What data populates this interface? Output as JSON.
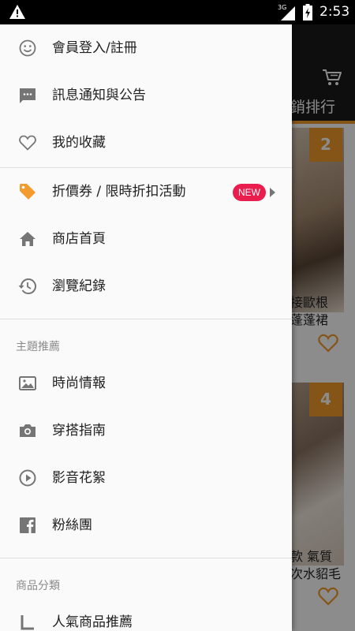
{
  "status_bar": {
    "network_label": "3G",
    "time": "2:53"
  },
  "background_app": {
    "tab_label": "銷排行",
    "cards": [
      {
        "rank": "2",
        "text_line1": "接歐根",
        "text_line2": "蓬蓬裙"
      },
      {
        "rank": "4",
        "text_line1": "款 氣質",
        "text_line2": "次水貂毛"
      }
    ],
    "colors": {
      "accent": "#f39b2c",
      "toolbar": "#1a1a1a"
    }
  },
  "drawer": {
    "items_top": [
      {
        "label": "會員登入/註冊",
        "icon": "smiley-icon"
      },
      {
        "label": "訊息通知與公告",
        "icon": "message-icon"
      },
      {
        "label": "我的收藏",
        "icon": "heart-outline-icon"
      }
    ],
    "items_main": [
      {
        "label": "折價券 / 限時折扣活動",
        "icon": "tag-icon",
        "badge": "NEW"
      },
      {
        "label": "商店首頁",
        "icon": "home-icon"
      },
      {
        "label": "瀏覽紀錄",
        "icon": "history-icon"
      }
    ],
    "section_theme": {
      "title": "主題推薦",
      "items": [
        {
          "label": "時尚情報",
          "icon": "image-icon"
        },
        {
          "label": "穿搭指南",
          "icon": "camera-icon"
        },
        {
          "label": "影音花絮",
          "icon": "play-circle-icon"
        },
        {
          "label": "粉絲團",
          "icon": "facebook-icon"
        }
      ]
    },
    "section_category": {
      "title": "商品分類",
      "items": [
        {
          "label": "人氣商品推薦",
          "icon": "subdirectory-icon"
        }
      ]
    },
    "colors": {
      "tag_icon": "#f39b2c",
      "new_badge": "#e91e4f"
    }
  }
}
